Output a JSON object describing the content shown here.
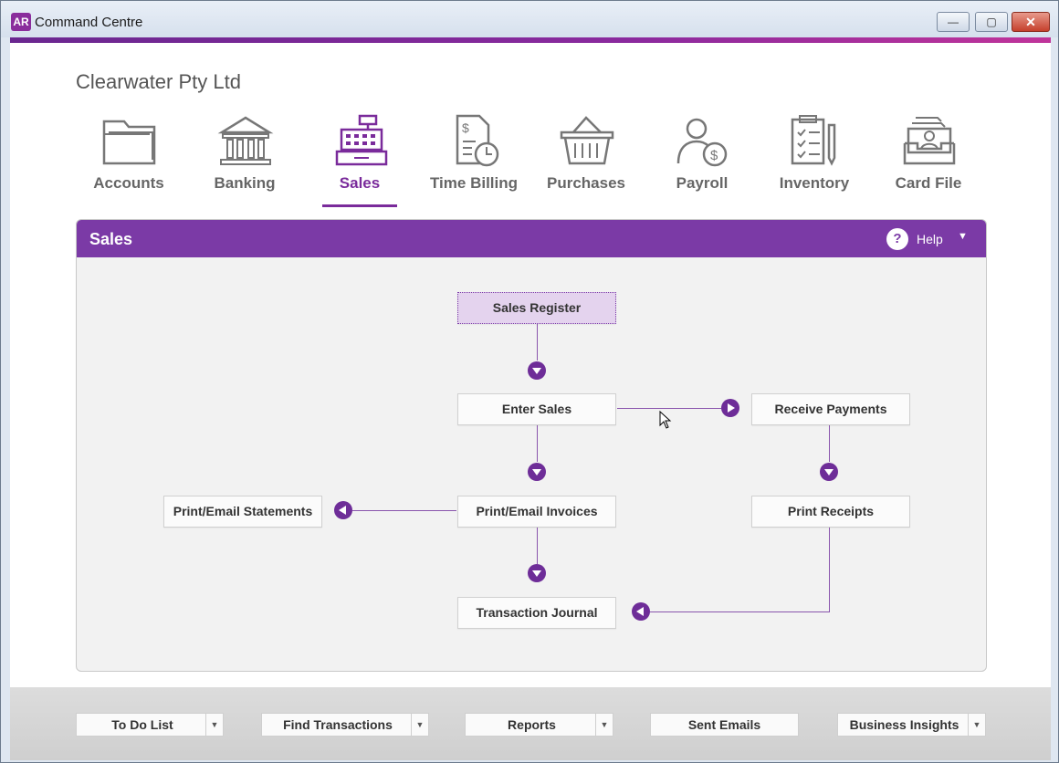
{
  "window": {
    "app_badge": "AR",
    "title": "Command Centre",
    "min_symbol": "—",
    "max_symbol": "▢",
    "close_symbol": "✕"
  },
  "company_name": "Clearwater Pty Ltd",
  "nav": {
    "active": "Sales",
    "items": [
      {
        "label": "Accounts",
        "icon": "folder-icon"
      },
      {
        "label": "Banking",
        "icon": "bank-icon"
      },
      {
        "label": "Sales",
        "icon": "cash-register-icon"
      },
      {
        "label": "Time Billing",
        "icon": "clock-document-icon"
      },
      {
        "label": "Purchases",
        "icon": "basket-icon"
      },
      {
        "label": "Payroll",
        "icon": "person-dollar-icon"
      },
      {
        "label": "Inventory",
        "icon": "clipboard-icon"
      },
      {
        "label": "Card File",
        "icon": "card-file-icon"
      }
    ]
  },
  "panel": {
    "title": "Sales",
    "help_label": "Help",
    "help_symbol": "?",
    "help_caret": "▼",
    "flow": {
      "sales_register": "Sales Register",
      "enter_sales": "Enter Sales",
      "receive_payments": "Receive Payments",
      "print_email_statements": "Print/Email Statements",
      "print_email_invoices": "Print/Email Invoices",
      "print_receipts": "Print Receipts",
      "transaction_journal": "Transaction Journal"
    }
  },
  "bottom_bar": {
    "to_do_list": "To Do List",
    "find_transactions": "Find Transactions",
    "reports": "Reports",
    "sent_emails": "Sent Emails",
    "business_insights": "Business Insights",
    "dropdown_symbol": "▼"
  },
  "colors": {
    "brand_purple": "#7b3aa6",
    "arrow_purple": "#6e2d98"
  }
}
